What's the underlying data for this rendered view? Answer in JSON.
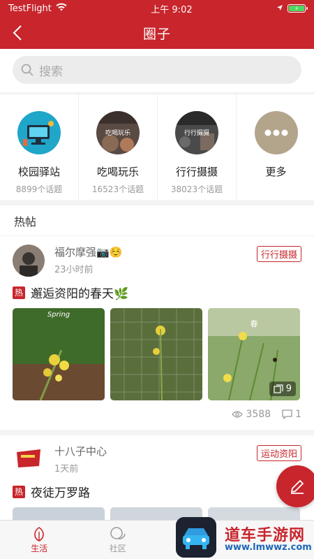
{
  "status_bar": {
    "carrier": "TestFlight",
    "time": "上午 9:02",
    "battery_icon": "battery-charging-icon"
  },
  "navbar": {
    "back_icon": "chevron-left-icon",
    "title": "圈子"
  },
  "search": {
    "placeholder": "搜索",
    "icon": "search-icon"
  },
  "categories": [
    {
      "name": "校园驿站",
      "count": "8899个话题",
      "image_label": ""
    },
    {
      "name": "吃喝玩乐",
      "count": "16523个话题",
      "image_label": "吃喝玩乐"
    },
    {
      "name": "行行摄摄",
      "count": "38023个话题",
      "image_label": "行行摄摄"
    },
    {
      "name": "更多",
      "count": "",
      "image_label": ""
    }
  ],
  "hot_section": {
    "title": "热帖"
  },
  "posts": [
    {
      "author": "福尔摩强📷☺️",
      "time": "23小时前",
      "tag": "行行摄摄",
      "hot_badge": "热",
      "title": "邂逅资阳的春天🌿",
      "photo_overlay_text": [
        "Spring",
        "",
        "春"
      ],
      "more_photos": "9",
      "views": "3588",
      "comments": "1"
    },
    {
      "author": "十八子中心",
      "time": "1天前",
      "tag": "运动资阳",
      "hot_badge": "热",
      "title": "夜徒万罗路"
    }
  ],
  "tabbar": [
    {
      "label": "生活",
      "icon": "leaf-icon",
      "active": true
    },
    {
      "label": "社区",
      "icon": "chat-bubble-icon",
      "active": false
    }
  ],
  "fab": {
    "icon": "edit-pencil-icon"
  },
  "watermark": {
    "text": "道车手游网",
    "url": "www.lmwwz.com"
  },
  "colors": {
    "brand_red": "#c8252c",
    "background": "#f4f4f4",
    "muted_text": "#999999"
  }
}
